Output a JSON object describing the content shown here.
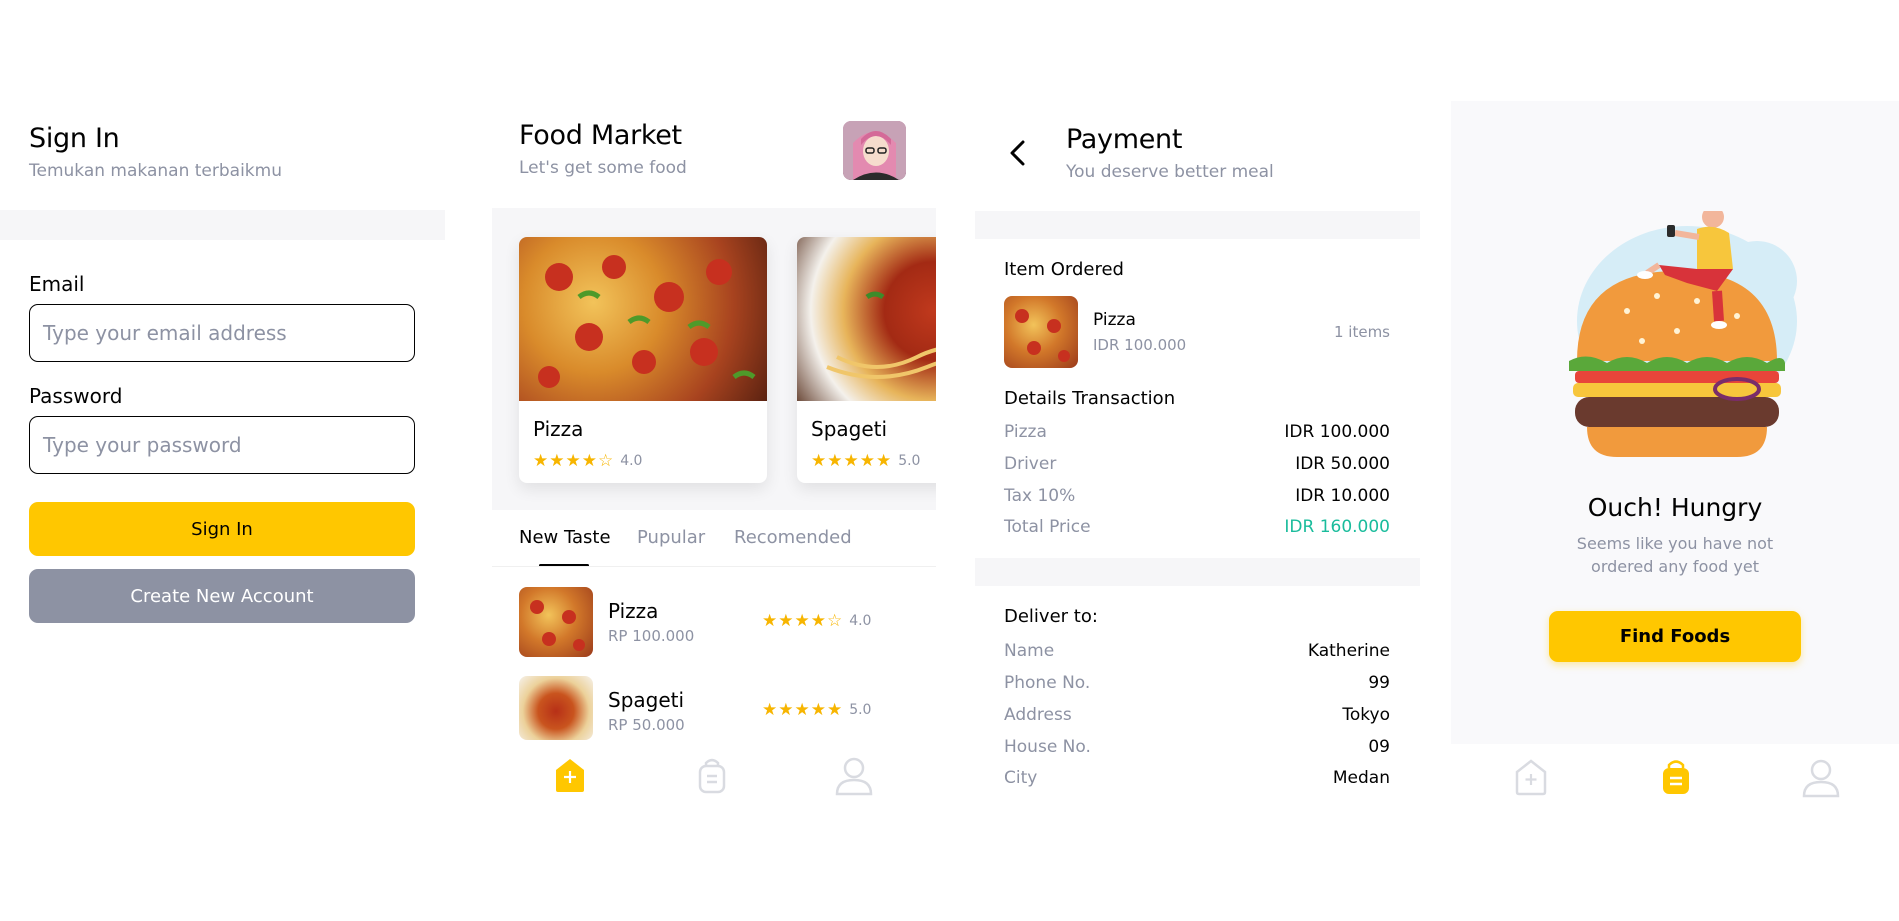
{
  "signin": {
    "title": "Sign In",
    "subtitle": "Temukan makanan terbaikmu",
    "email_label": "Email",
    "email_placeholder": "Type your email address",
    "password_label": "Password",
    "password_placeholder": "Type your password",
    "signin_button": "Sign In",
    "create_button": "Create New Account"
  },
  "market": {
    "title": "Food Market",
    "subtitle": "Let's get some food",
    "cards": [
      {
        "name": "Pizza",
        "rating": "4.0",
        "stars": "★★★★☆"
      },
      {
        "name": "Spageti",
        "rating": "5.0",
        "stars": "★★★★★"
      }
    ],
    "tabs": [
      "New Taste",
      "Pupular",
      "Recomended"
    ],
    "list": [
      {
        "name": "Pizza",
        "price": "RP 100.000",
        "rating": "4.0",
        "stars": "★★★★☆"
      },
      {
        "name": "Spageti",
        "price": "RP 50.000",
        "rating": "5.0",
        "stars": "★★★★★"
      }
    ]
  },
  "payment": {
    "title": "Payment",
    "subtitle": "You deserve better meal",
    "item_ordered_label": "Item Ordered",
    "item": {
      "name": "Pizza",
      "price": "IDR 100.000",
      "qty": "1 items"
    },
    "details_label": "Details Transaction",
    "details": [
      {
        "label": "Pizza",
        "value": "IDR 100.000"
      },
      {
        "label": "Driver",
        "value": "IDR 50.000"
      },
      {
        "label": "Tax 10%",
        "value": "IDR 10.000"
      },
      {
        "label": "Total Price",
        "value": "IDR 160.000"
      }
    ],
    "deliver_label": "Deliver to:",
    "deliver": [
      {
        "label": "Name",
        "value": "Katherine"
      },
      {
        "label": "Phone No.",
        "value": "99"
      },
      {
        "label": "Address",
        "value": "Tokyo"
      },
      {
        "label": "House No.",
        "value": "09"
      },
      {
        "label": "City",
        "value": "Medan"
      }
    ]
  },
  "empty": {
    "title": "Ouch! Hungry",
    "message_line1": "Seems like you have not",
    "message_line2": "ordered any food yet",
    "button": "Find Foods"
  },
  "colors": {
    "accent": "#ffc700",
    "grey_button": "#8d92a3",
    "total_green": "#1abc9c",
    "text_grey": "#8d92a3"
  },
  "icons": {
    "back": "chevron-left-icon",
    "home": "home-icon",
    "bag": "order-bag-icon",
    "profile": "profile-icon",
    "star": "star-icon"
  }
}
